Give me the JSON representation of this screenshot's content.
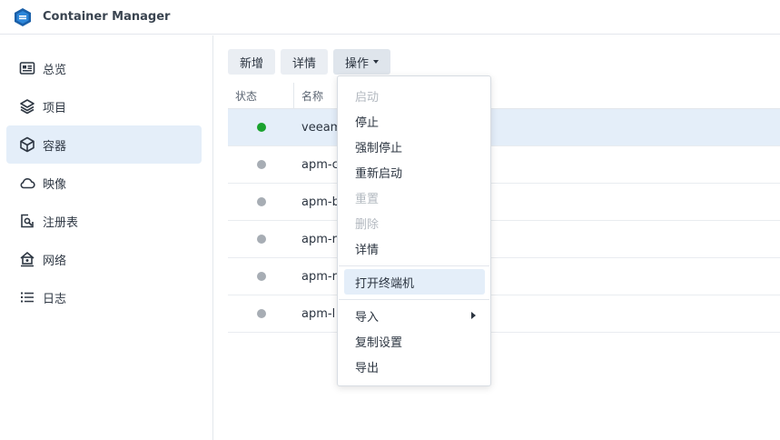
{
  "app": {
    "title": "Container Manager",
    "icon": "container-manager-logo-icon",
    "accent_color": "#1a5fa8"
  },
  "sidebar": {
    "items": [
      {
        "label": "总览",
        "icon": "overview-icon",
        "active": false
      },
      {
        "label": "项目",
        "icon": "project-layers-icon",
        "active": false
      },
      {
        "label": "容器",
        "icon": "container-cube-icon",
        "active": true
      },
      {
        "label": "映像",
        "icon": "cloud-icon",
        "active": false
      },
      {
        "label": "注册表",
        "icon": "registry-search-icon",
        "active": false
      },
      {
        "label": "网络",
        "icon": "network-icon",
        "active": false
      },
      {
        "label": "日志",
        "icon": "log-list-icon",
        "active": false
      }
    ]
  },
  "toolbar": {
    "add_label": "新增",
    "details_label": "详情",
    "actions_label": "操作"
  },
  "table": {
    "columns": [
      "状态",
      "名称"
    ],
    "rows": [
      {
        "name": "veeam",
        "status": "running",
        "selected": true
      },
      {
        "name": "apm-c",
        "status": "stopped",
        "selected": false
      },
      {
        "name": "apm-b",
        "status": "stopped",
        "selected": false
      },
      {
        "name": "apm-r",
        "status": "stopped",
        "selected": false
      },
      {
        "name": "apm-r",
        "status": "stopped",
        "selected": false
      },
      {
        "name": "apm-l",
        "status": "stopped",
        "selected": false
      }
    ]
  },
  "actions_menu": {
    "items": [
      {
        "label": "启动",
        "disabled": true
      },
      {
        "label": "停止",
        "disabled": false
      },
      {
        "label": "强制停止",
        "disabled": false
      },
      {
        "label": "重新启动",
        "disabled": false
      },
      {
        "label": "重置",
        "disabled": true
      },
      {
        "label": "删除",
        "disabled": true
      },
      {
        "label": "详情",
        "disabled": false
      },
      {
        "label": "打开终端机",
        "disabled": false,
        "highlighted": true
      },
      {
        "label": "导入",
        "disabled": false,
        "has_submenu": true
      },
      {
        "label": "复制设置",
        "disabled": false
      },
      {
        "label": "导出",
        "disabled": false
      }
    ]
  },
  "colors": {
    "running": "#1aa22e",
    "stopped": "#a7adb4",
    "selection": "#e4eef9"
  }
}
